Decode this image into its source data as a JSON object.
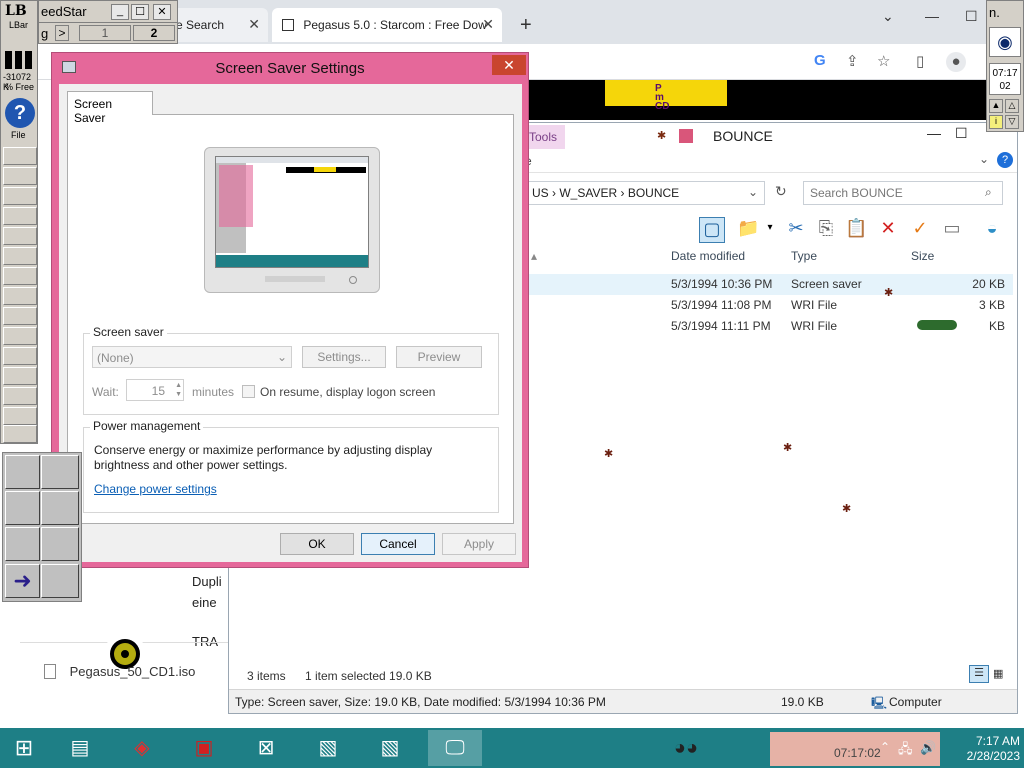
{
  "browser": {
    "tabs": [
      {
        "label": "e Search"
      },
      {
        "label": "Pegasus 5.0 : Starcom : Free Dow"
      }
    ],
    "new_tab": "+"
  },
  "speedstar": {
    "title": "eedStar",
    "row_label": "g",
    "col1": "1",
    "col2": "2"
  },
  "lbar": {
    "logo": "LB",
    "label": "LBar",
    "memory": "-31072 K",
    "free": "% Free",
    "file_label": "File"
  },
  "right_panel": {
    "top_label": "n.",
    "time1": "07:17",
    "time2": "02"
  },
  "explorer": {
    "tools_tab": "Tools",
    "title": "BOUNCE",
    "ribbon_letter": "e",
    "breadcrumb": [
      "US",
      "W_SAVER",
      "BOUNCE"
    ],
    "search_placeholder": "Search BOUNCE",
    "columns": {
      "date": "Date modified",
      "type": "Type",
      "size": "Size"
    },
    "rows": [
      {
        "date": "5/3/1994 10:36 PM",
        "type": "Screen saver",
        "size": "20 KB"
      },
      {
        "date": "5/3/1994 11:08 PM",
        "type": "WRI File",
        "size": "3 KB"
      },
      {
        "date": "5/3/1994 11:11 PM",
        "type": "WRI File",
        "size": "KB"
      }
    ],
    "status_items": "3 items",
    "status_selected": "1 item selected  19.0 KB",
    "detail_text": "Type: Screen saver, Size: 19.0 KB, Date modified: 5/3/1994 10:36 PM",
    "detail_size": "19.0 KB",
    "detail_computer": "Computer"
  },
  "left_doc": {
    "line1": "Dupli",
    "line2": "eine",
    "line3": "TRA",
    "iso_file": "Pegasus_50_CD1.iso"
  },
  "dialog": {
    "title": "Screen Saver Settings",
    "close": "✕",
    "tab": "Screen Saver",
    "screensaver_group": "Screen saver",
    "select_value": "(None)",
    "settings_button": "Settings...",
    "preview_button": "Preview",
    "wait_label": "Wait:",
    "wait_value": "15",
    "minutes_label": "minutes",
    "resume_label": "On resume, display logon screen",
    "power_group": "Power management",
    "power_text1": "Conserve energy or maximize performance by adjusting display",
    "power_text2": "brightness and other power settings.",
    "power_link": "Change power settings",
    "ok": "OK",
    "cancel": "Cancel",
    "apply": "Apply"
  },
  "taskbar": {
    "clock_time": "7:17 AM",
    "clock_date": "2/28/2023",
    "tray_clock": "07:17:02"
  },
  "colors": {
    "dialog_frame": "#e5689a",
    "taskbar": "#1e7f86",
    "close_button": "#c9452f"
  }
}
